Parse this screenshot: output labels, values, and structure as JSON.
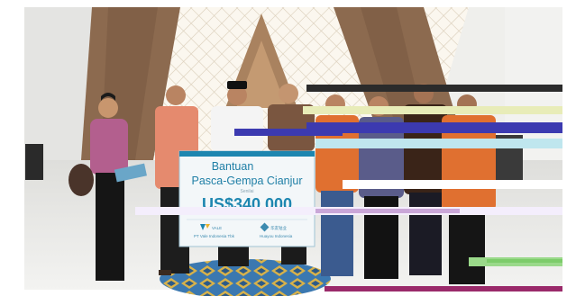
{
  "sign": {
    "title_line1": "Bantuan",
    "title_line2": "Pasca-Gempa Cianjur",
    "small_label": "Senilai",
    "amount": "US$340.000",
    "logo_left_text": "PT Vale Indonesia Tbk",
    "logo_right_text": "Huayou Indonesia",
    "logo_left_mark": "VALE",
    "logo_right_mark": "华友钴业"
  },
  "colors": {
    "ceiling": "#f6f2ea",
    "arch_brown": "#8c6a4f",
    "floor": "#e9e9e6",
    "sign_bg": "#f3f7f9",
    "sign_blue": "#1d86b0",
    "orange_shirt": "#e07030",
    "rug_blue": "#2f6aa0"
  }
}
